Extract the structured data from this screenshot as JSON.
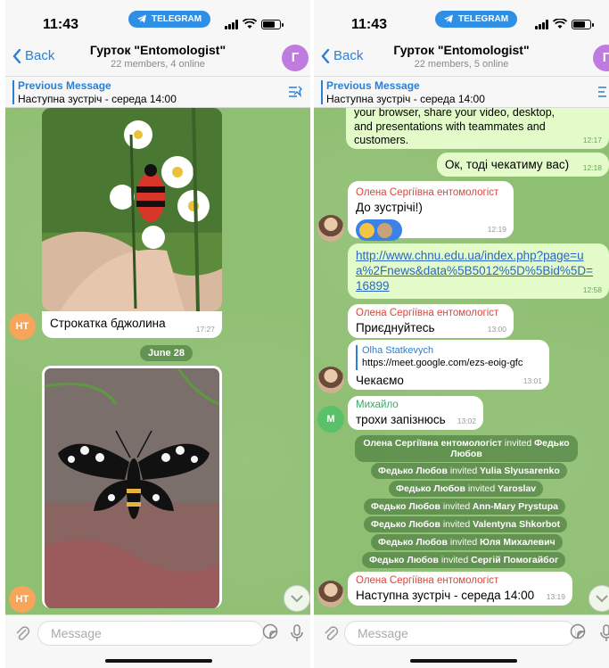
{
  "status": {
    "time": "11:43",
    "app_pill": "TELEGRAM"
  },
  "left": {
    "header": {
      "back": "Back",
      "title": "Гурток \"Entomologist\"",
      "subtitle": "22 members, 4 online",
      "avatar_letter": "Г"
    },
    "pinned": {
      "title": "Previous Message",
      "text": "Наступна зустріч - середа 14:00"
    },
    "messages": {
      "photo1_caption": "Строкатка бджолина",
      "photo1_time": "17:27",
      "date": "June 28",
      "avatar_initials": "НТ"
    },
    "composer": {
      "placeholder": "Message"
    }
  },
  "right": {
    "header": {
      "back": "Back",
      "title": "Гурток \"Entomologist\"",
      "subtitle": "22 members, 5 online",
      "avatar_letter": "Г"
    },
    "pinned": {
      "title": "Previous Message",
      "text": "Наступна зустріч - середа 14:00"
    },
    "messages": {
      "m1_text": "your browser, share your video, desktop, and presentations with teammates and customers.",
      "m1_time": "12:17",
      "m2_text": "Ок, тоді чекатиму вас)",
      "m2_time": "12:18",
      "m3_sender": "Олена Сергіївна ентомологіст",
      "m3_text": "До зустрічі!)",
      "m3_time": "12:19",
      "m4_link": "http://www.chnu.edu.ua/index.php?page=ua%2Fnews&data%5B5012%5D%5Bid%5D=16899",
      "m4_time": "12:58",
      "m5_sender": "Олена Сергіївна ентомологіст",
      "m5_text": "Приєднуйтесь",
      "m5_time": "13:00",
      "m6_reply_name": "Olha Statkevych",
      "m6_reply_text": "https://meet.google.com/ezs-eoig-gfc",
      "m6_text": "Чекаємо",
      "m6_time": "13:01",
      "m7_sender": "Михайло",
      "m7_text": "трохи запізнюсь",
      "m7_time": "13:02",
      "m7_avatar": "М",
      "m8_sender": "Олена Сергіївна ентомологіст",
      "m8_text": "Наступна зустріч - середа 14:00",
      "m8_time": "13:19"
    },
    "system": [
      {
        "actor": "Олена Сергіївна ентомологіст",
        "verb": "invited",
        "target": "Федько Любов"
      },
      {
        "actor": "Федько Любов",
        "verb": "invited",
        "target": "Yulia Slyusarenko"
      },
      {
        "actor": "Федько Любов",
        "verb": "invited",
        "target": "Yaroslav"
      },
      {
        "actor": "Федько Любов",
        "verb": "invited",
        "target": "Ann-Mary Prystupa"
      },
      {
        "actor": "Федько Любов",
        "verb": "invited",
        "target": "Valentyna Shkorbot"
      },
      {
        "actor": "Федько Любов",
        "verb": "invited",
        "target": "Юля Михалевич"
      },
      {
        "actor": "Федько Любов",
        "verb": "invited",
        "target": "Сергій Помогайбог"
      }
    ],
    "composer": {
      "placeholder": "Message"
    }
  }
}
